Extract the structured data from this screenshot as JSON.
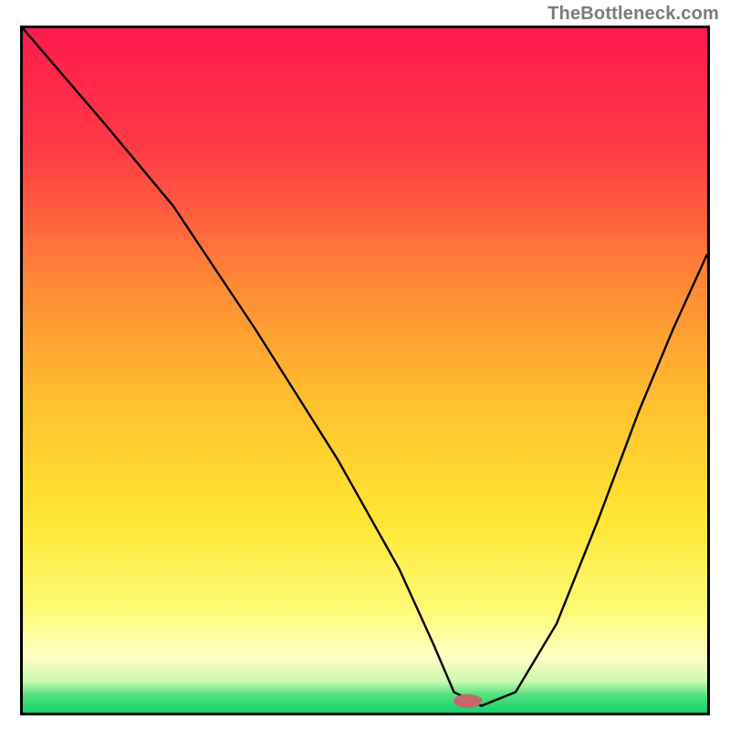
{
  "attribution": "TheBottleneck.com",
  "chart_data": {
    "type": "line",
    "title": "",
    "xlabel": "",
    "ylabel": "",
    "xlim": [
      0,
      100
    ],
    "ylim": [
      0,
      100
    ],
    "axes_visible": false,
    "background": {
      "type": "vertical-gradient",
      "stops": [
        {
          "offset": 0.0,
          "color": "#ff1a4e"
        },
        {
          "offset": 0.18,
          "color": "#ff3b46"
        },
        {
          "offset": 0.38,
          "color": "#ff8b35"
        },
        {
          "offset": 0.55,
          "color": "#ffc12f"
        },
        {
          "offset": 0.72,
          "color": "#ffe633"
        },
        {
          "offset": 0.85,
          "color": "#fffb77"
        },
        {
          "offset": 0.92,
          "color": "#ffffc7"
        },
        {
          "offset": 0.955,
          "color": "#c9f8af"
        },
        {
          "offset": 0.975,
          "color": "#4ee07e"
        },
        {
          "offset": 1.0,
          "color": "#17d36e"
        }
      ]
    },
    "series": [
      {
        "name": "bottleneck-curve",
        "color": "#000000",
        "width": 2.4,
        "x": [
          0,
          12,
          22,
          34,
          46,
          55,
          60,
          63,
          67,
          72,
          78,
          84,
          90,
          95,
          100
        ],
        "y": [
          100,
          86,
          74,
          56,
          37,
          21,
          10,
          3,
          1,
          3,
          13,
          28,
          44,
          56,
          67
        ]
      }
    ],
    "marker": {
      "name": "optimal-point",
      "x": 65,
      "y": 1.7,
      "color": "#c46a6a",
      "rx": 2.1,
      "ry": 1.0
    }
  }
}
